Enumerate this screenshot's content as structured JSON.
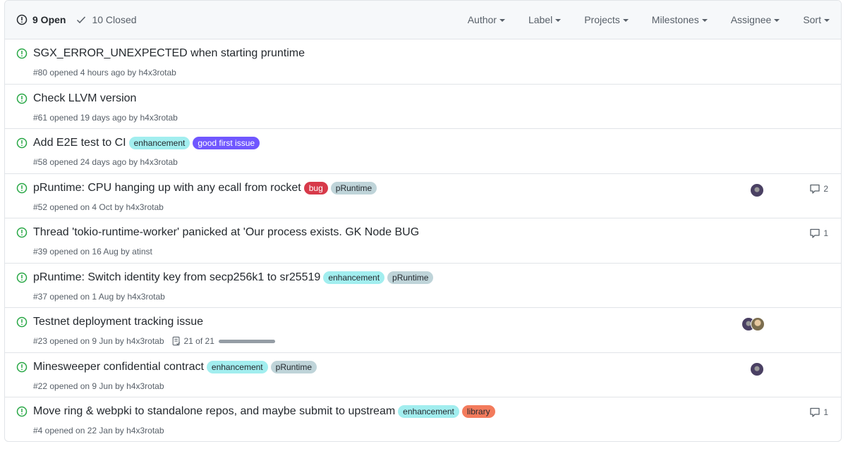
{
  "header": {
    "open_count": "9 Open",
    "closed_count": "10 Closed",
    "filters": [
      "Author",
      "Label",
      "Projects",
      "Milestones",
      "Assignee",
      "Sort"
    ]
  },
  "colors": {
    "open_icon": "#28a745",
    "enhancement": "#a2eeef",
    "good_first_issue": "#7057ff",
    "bug": "#d73a4a",
    "pRuntime": "#bfd4d9",
    "library": "#f37b5c"
  },
  "issues": [
    {
      "title": "SGX_ERROR_UNEXPECTED when starting pruntime",
      "meta": "#80 opened 4 hours ago by ",
      "author": "h4x3rotab",
      "labels": [],
      "avatars": 0,
      "comments": ""
    },
    {
      "title": "Check LLVM version",
      "meta": "#61 opened 19 days ago by ",
      "author": "h4x3rotab",
      "labels": [],
      "avatars": 0,
      "comments": ""
    },
    {
      "title": "Add E2E test to CI",
      "meta": "#58 opened 24 days ago by ",
      "author": "h4x3rotab",
      "labels": [
        {
          "name": "enhancement",
          "bg": "#a2eeef",
          "fg": "#24292e"
        },
        {
          "name": "good first issue",
          "bg": "#7057ff",
          "fg": "#ffffff"
        }
      ],
      "avatars": 0,
      "comments": ""
    },
    {
      "title": "pRuntime: CPU hanging up with any ecall from rocket",
      "meta": "#52 opened on 4 Oct by ",
      "author": "h4x3rotab",
      "labels": [
        {
          "name": "bug",
          "bg": "#d73a4a",
          "fg": "#ffffff"
        },
        {
          "name": "pRuntime",
          "bg": "#bfd4d9",
          "fg": "#24292e"
        }
      ],
      "avatars": 1,
      "comments": "2"
    },
    {
      "title": "Thread 'tokio-runtime-worker' panicked at 'Our process exists. GK Node BUG",
      "meta": "#39 opened on 16 Aug by ",
      "author": "atinst",
      "labels": [],
      "avatars": 0,
      "comments": "1"
    },
    {
      "title": "pRuntime: Switch identity key from secp256k1 to sr25519",
      "meta": "#37 opened on 1 Aug by ",
      "author": "h4x3rotab",
      "labels": [
        {
          "name": "enhancement",
          "bg": "#a2eeef",
          "fg": "#24292e"
        },
        {
          "name": "pRuntime",
          "bg": "#bfd4d9",
          "fg": "#24292e"
        }
      ],
      "avatars": 0,
      "comments": ""
    },
    {
      "title": "Testnet deployment tracking issue",
      "meta": "#23 opened on 9 Jun by ",
      "author": "h4x3rotab",
      "labels": [],
      "avatars": 2,
      "comments": "",
      "tasks": "21 of 21",
      "task_progress": 1.0
    },
    {
      "title": "Minesweeper confidential contract",
      "meta": "#22 opened on 9 Jun by ",
      "author": "h4x3rotab",
      "labels": [
        {
          "name": "enhancement",
          "bg": "#a2eeef",
          "fg": "#24292e"
        },
        {
          "name": "pRuntime",
          "bg": "#bfd4d9",
          "fg": "#24292e"
        }
      ],
      "avatars": 1,
      "comments": ""
    },
    {
      "title": "Move ring & webpki to standalone repos, and maybe submit to upstream",
      "meta": "#4 opened on 22 Jan by ",
      "author": "h4x3rotab",
      "labels": [
        {
          "name": "enhancement",
          "bg": "#a2eeef",
          "fg": "#24292e"
        },
        {
          "name": "library",
          "bg": "#f37b5c",
          "fg": "#24292e"
        }
      ],
      "avatars": 0,
      "comments": "1"
    }
  ]
}
